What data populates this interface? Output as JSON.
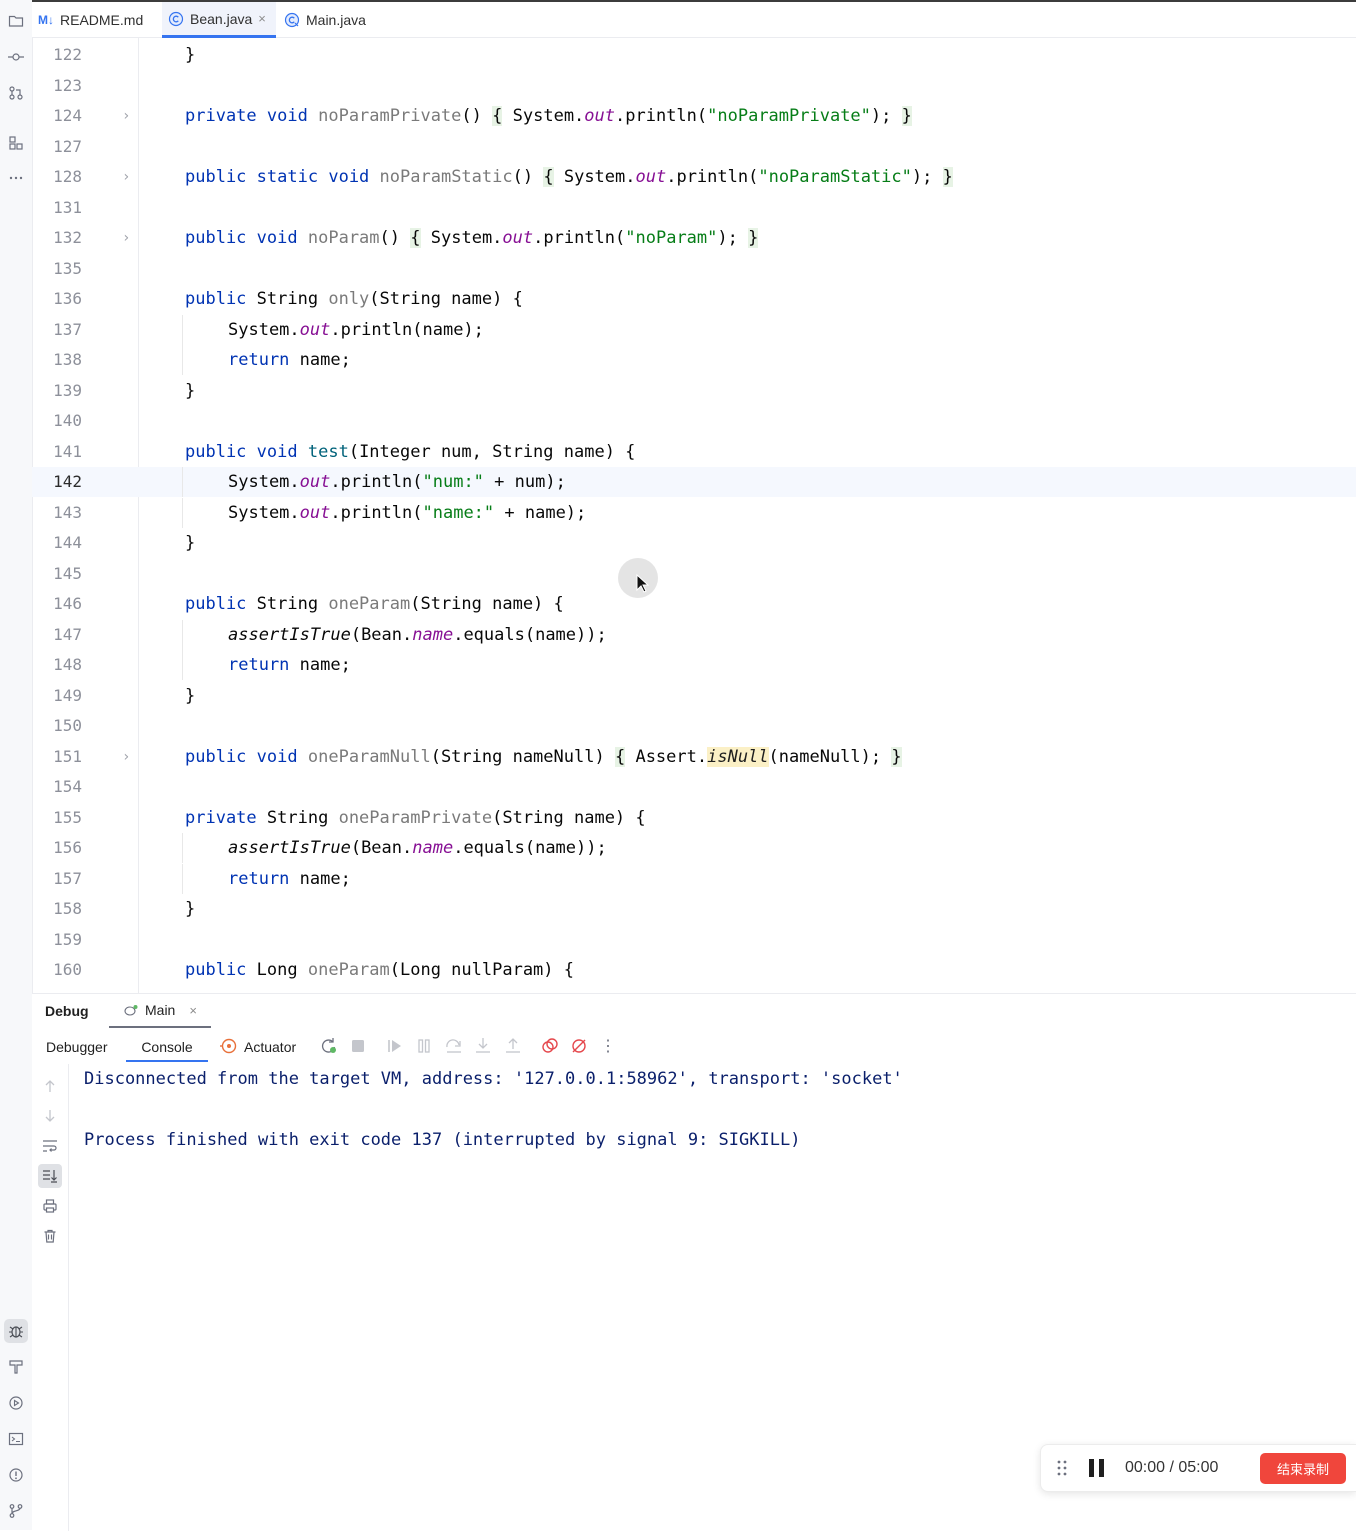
{
  "tabs": [
    {
      "label": "README.md",
      "icon": "markdown-icon",
      "badge": "M↓"
    },
    {
      "label": "Bean.java",
      "icon": "java-class-icon",
      "active": true,
      "close": "×"
    },
    {
      "label": "Main.java",
      "icon": "java-class-icon"
    }
  ],
  "editor": {
    "current_line": "142",
    "lines": [
      {
        "n": "122"
      },
      {
        "n": "123"
      },
      {
        "n": "124"
      },
      {
        "n": "127"
      },
      {
        "n": "128"
      },
      {
        "n": "131"
      },
      {
        "n": "132"
      },
      {
        "n": "135"
      },
      {
        "n": "136"
      },
      {
        "n": "137"
      },
      {
        "n": "138"
      },
      {
        "n": "139"
      },
      {
        "n": "140"
      },
      {
        "n": "141"
      },
      {
        "n": "142"
      },
      {
        "n": "143"
      },
      {
        "n": "144"
      },
      {
        "n": "145"
      },
      {
        "n": "146"
      },
      {
        "n": "147"
      },
      {
        "n": "148"
      },
      {
        "n": "149"
      },
      {
        "n": "150"
      },
      {
        "n": "151"
      },
      {
        "n": "154"
      },
      {
        "n": "155"
      },
      {
        "n": "156"
      },
      {
        "n": "157"
      },
      {
        "n": "158"
      },
      {
        "n": "159"
      },
      {
        "n": "160"
      }
    ],
    "code": {
      "l122": "}",
      "l124": [
        "private",
        "void",
        "noParamPrivate",
        "()",
        "{",
        "System.",
        "out",
        ".println(",
        "\"noParamPrivate\"",
        ");",
        "}"
      ],
      "l128": [
        "public",
        "static",
        "void",
        "noParamStatic",
        "()",
        "{",
        "System.",
        "out",
        ".println(",
        "\"noParamStatic\"",
        ");",
        "}"
      ],
      "l132": [
        "public",
        "void",
        "noParam",
        "()",
        "{",
        "System.",
        "out",
        ".println(",
        "\"noParam\"",
        ");",
        "}"
      ],
      "l136": [
        "public",
        "String",
        "only",
        "(String name) {"
      ],
      "l137": [
        "System.",
        "out",
        ".println(name);"
      ],
      "l138": [
        "return",
        "name;"
      ],
      "l139": "}",
      "l141": [
        "public",
        "void",
        "test",
        "(Integer num, String name) {"
      ],
      "l142": [
        "System.",
        "out",
        ".println(",
        "\"num:\"",
        " + num);"
      ],
      "l143": [
        "System.",
        "out",
        ".println(",
        "\"name:\"",
        " + name);"
      ],
      "l144": "}",
      "l146": [
        "public",
        "String",
        "oneParam",
        "(String name) {"
      ],
      "l147": [
        "assertIsTrue",
        "(Bean.",
        "name",
        ".equals(name));"
      ],
      "l148": [
        "return",
        "name;"
      ],
      "l149": "}",
      "l151": [
        "public",
        "void",
        "oneParamNull",
        "(String nameNull)",
        "{",
        "Assert.",
        "isNull",
        "(nameNull);",
        "}"
      ],
      "l155": [
        "private",
        "String",
        "oneParamPrivate",
        "(String name) {"
      ],
      "l156": [
        "assertIsTrue",
        "(Bean.",
        "name",
        ".equals(name));"
      ],
      "l157": [
        "return",
        "name;"
      ],
      "l158": "}",
      "l160": [
        "public",
        "Long",
        "oneParam",
        "(Long nullParam) {"
      ]
    }
  },
  "debug": {
    "title": "Debug",
    "session_tab": "Main",
    "session_close": "×",
    "subtabs": [
      "Debugger",
      "Console"
    ],
    "active_subtab": "Console",
    "actuator_label": "Actuator",
    "more": "⋮",
    "console_lines": [
      "Disconnected from the target VM, address: '127.0.0.1:58962', transport: 'socket'",
      "Process finished with exit code 137 (interrupted by signal 9: SIGKILL)"
    ]
  },
  "recorder": {
    "time": "00:00 / 05:00",
    "stop_label": "结束录制",
    "stop_color": "#f0463c"
  },
  "colors": {
    "keyword": "#0033b3",
    "string": "#067d17",
    "field": "#871094",
    "console_text": "#0a1f6b",
    "accent": "#3574f0"
  }
}
